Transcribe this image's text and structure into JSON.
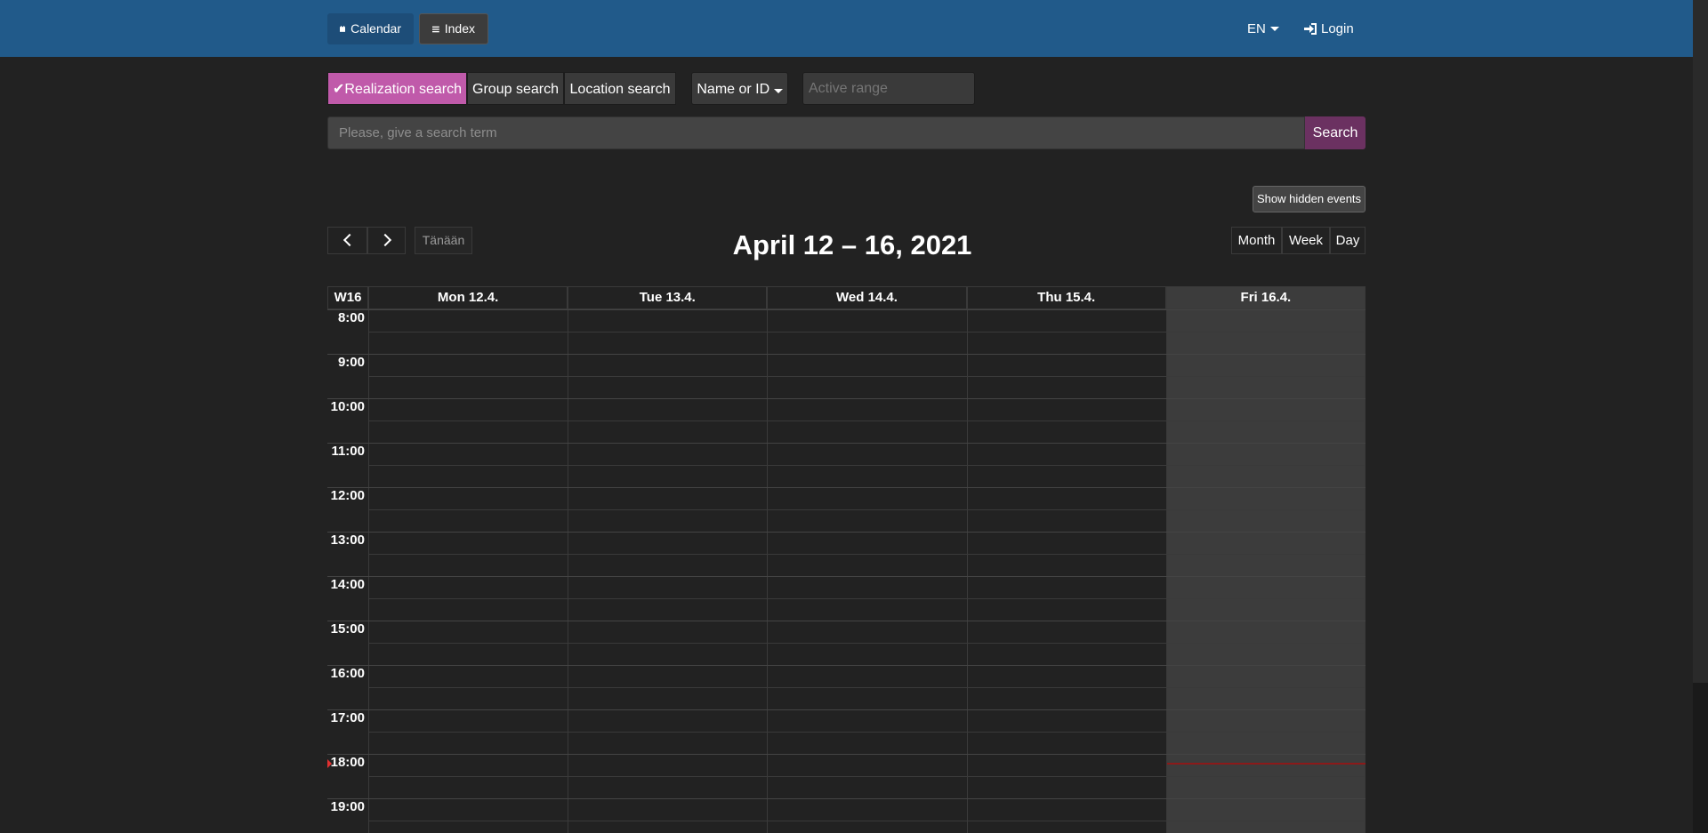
{
  "nav": {
    "calendar_label": "Calendar",
    "index_label": "Index",
    "language": "EN",
    "login_label": "Login"
  },
  "search_modes": {
    "realization": "Realization search",
    "group": "Group search",
    "location": "Location search",
    "field_filter": "Name or ID",
    "active_range_placeholder": "Active range"
  },
  "search": {
    "placeholder": "Please, give a search term",
    "button": "Search"
  },
  "calendar": {
    "show_hidden_label": "Show hidden events",
    "today_label": "Tänään",
    "title": "April 12 – 16, 2021",
    "views": [
      "Month",
      "Week",
      "Day"
    ],
    "week_label": "W16",
    "days": [
      "Mon 12.4.",
      "Tue 13.4.",
      "Wed 14.4.",
      "Thu 15.4.",
      "Fri 16.4."
    ],
    "times": [
      "8:00",
      "9:00",
      "10:00",
      "11:00",
      "12:00",
      "13:00",
      "14:00",
      "15:00",
      "16:00",
      "17:00",
      "18:00",
      "19:00"
    ],
    "today_index": 4
  },
  "colors": {
    "topbar": "#215a8a",
    "accent_realization": "#c05aaa",
    "search_button": "#6b3161",
    "now_indicator": "#8b1a1a"
  }
}
